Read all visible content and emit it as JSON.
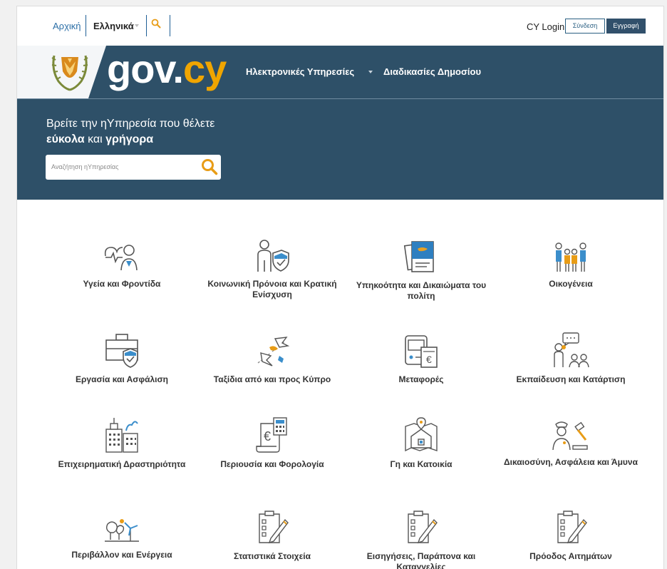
{
  "topbar": {
    "home": "Αρχική",
    "language": "Ελληνικά",
    "cy_login": "CY Login",
    "login_button": "Σύνδεση",
    "register_button": "Εγγραφή"
  },
  "header": {
    "logo_gov": "gov",
    "logo_dot": ".",
    "logo_cy": "cy",
    "nav_services": "Ηλεκτρονικές Υπηρεσίες",
    "nav_procedures": "Διαδικασίες Δημοσίου"
  },
  "hero": {
    "line1": "Βρείτε την ηΥπηρεσία που θέλετε",
    "bold1": "εύκολα",
    "connector": "και",
    "bold2": "γρήγορα",
    "search_placeholder": "Αναζήτηση ηΥπηρεσίας"
  },
  "categories": [
    {
      "label": "Υγεία και Φροντίδα",
      "icon": "health-icon"
    },
    {
      "label": "Κοινωνική Πρόνοια και Κρατική Ενίσχυση",
      "icon": "welfare-icon"
    },
    {
      "label": "Υπηκοότητα και Δικαιώματα του πολίτη",
      "icon": "citizenship-icon"
    },
    {
      "label": "Οικογένεια",
      "icon": "family-icon"
    },
    {
      "label": "Εργασία και Ασφάλιση",
      "icon": "work-icon"
    },
    {
      "label": "Ταξίδια από και προς Κύπρο",
      "icon": "travel-icon"
    },
    {
      "label": "Μεταφορές",
      "icon": "transport-icon"
    },
    {
      "label": "Εκπαίδευση και Κατάρτιση",
      "icon": "education-icon"
    },
    {
      "label": "Επιχειρηματική Δραστηριότητα",
      "icon": "business-icon"
    },
    {
      "label": "Περιουσία και Φορολογία",
      "icon": "property-tax-icon"
    },
    {
      "label": "Γη και Κατοικία",
      "icon": "land-housing-icon"
    },
    {
      "label": "Δικαιοσύνη, Ασφάλεια και Άμυνα",
      "icon": "justice-icon"
    },
    {
      "label": "Περιβάλλον και Ενέργεια",
      "icon": "environment-icon"
    },
    {
      "label": "Στατιστικά Στοιχεία",
      "icon": "statistics-icon"
    },
    {
      "label": "Εισηγήσεις, Παράπονα και Καταγγελίες",
      "icon": "complaints-icon"
    },
    {
      "label": "Πρόοδος Αιτημάτων",
      "icon": "requests-progress-icon"
    }
  ],
  "colors": {
    "brand_blue": "#2e5068",
    "accent": "#f0a500",
    "link": "#2b6ea6"
  }
}
